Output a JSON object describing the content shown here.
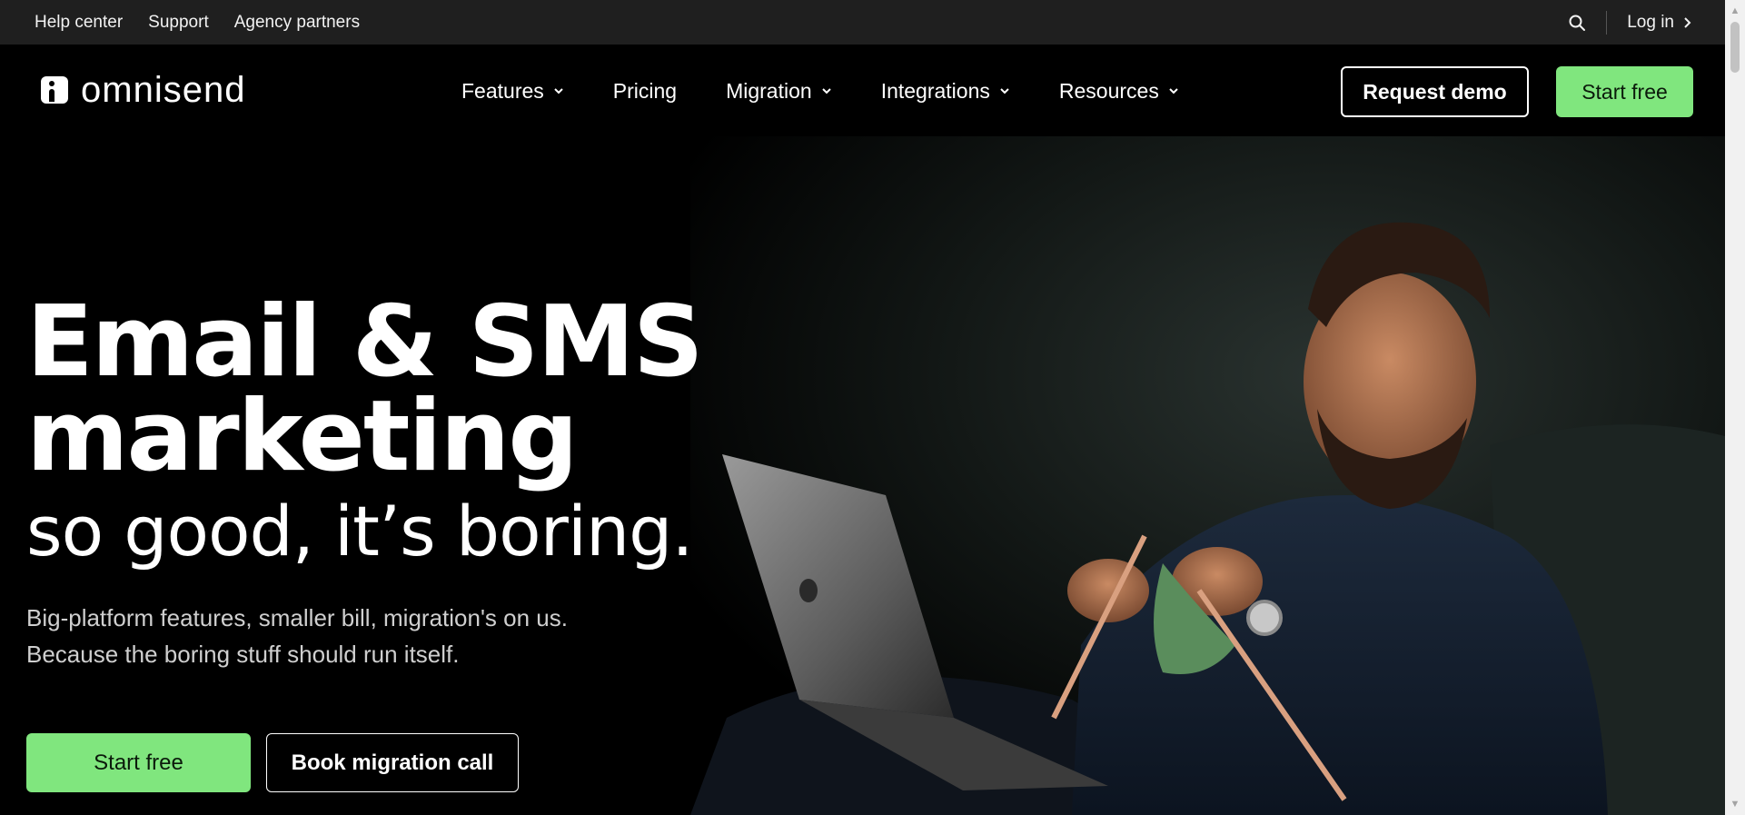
{
  "utility_bar": {
    "links": [
      "Help center",
      "Support",
      "Agency partners"
    ],
    "login_label": "Log in"
  },
  "brand": {
    "name": "omnisend"
  },
  "nav": {
    "items": [
      {
        "label": "Features",
        "has_dropdown": true
      },
      {
        "label": "Pricing",
        "has_dropdown": false
      },
      {
        "label": "Migration",
        "has_dropdown": true
      },
      {
        "label": "Integrations",
        "has_dropdown": true
      },
      {
        "label": "Resources",
        "has_dropdown": true
      }
    ],
    "request_demo_label": "Request demo",
    "start_free_label": "Start free"
  },
  "hero": {
    "title_line1": "Email & SMS",
    "title_line2": "marketing",
    "subtitle": "so good, it’s boring.",
    "description_line1": "Big-platform features, smaller bill, migration's on us.",
    "description_line2": "Because the boring stuff should run itself.",
    "primary_cta": "Start free",
    "secondary_cta": "Book migration call"
  },
  "colors": {
    "accent_green": "#80e67e",
    "background": "#000000",
    "utility_bar_bg": "#1f1f1f"
  },
  "icons": {
    "search": "search-icon",
    "chevron": "chevron-down-icon",
    "login_arrow": "chevron-right-icon"
  }
}
